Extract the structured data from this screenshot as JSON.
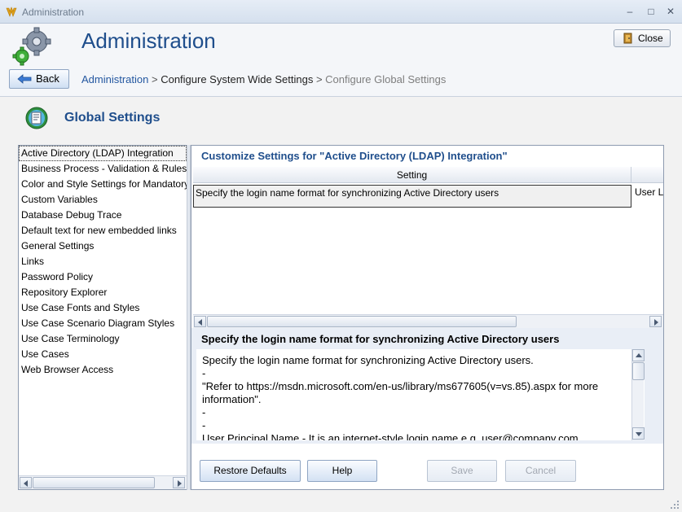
{
  "window": {
    "title": "Administration"
  },
  "header": {
    "title": "Administration",
    "close_label": "Close",
    "back_label": "Back",
    "breadcrumb": {
      "link": "Administration",
      "separator": " > ",
      "middle": "Configure System Wide Settings",
      "current": "Configure Global Settings"
    }
  },
  "section": {
    "title": "Global Settings"
  },
  "categories": [
    "Active Directory (LDAP) Integration",
    "Business Process - Validation & Rules",
    "Color and Style Settings for Mandatory",
    "Custom Variables",
    "Database Debug Trace",
    "Default text for new embedded links",
    "General Settings",
    "Links",
    "Password Policy",
    "Repository Explorer",
    "Use Case Fonts and Styles",
    "Use Case Scenario Diagram Styles",
    "Use Case Terminology",
    "Use Cases",
    "Web Browser Access"
  ],
  "customize": {
    "title": "Customize Settings for \"Active Directory (LDAP) Integration\"",
    "column_setting": "Setting",
    "rows": [
      {
        "setting": "Specify the login name format for synchronizing Active Directory users",
        "value": "User L"
      }
    ]
  },
  "description": {
    "title": "Specify the login name format for synchronizing Active Directory users",
    "lines": [
      "Specify the login name format for synchronizing Active Directory users.",
      "-",
      "\"Refer to https://msdn.microsoft.com/en-us/library/ms677605(v=vs.85).aspx for more information\".",
      "-",
      "-",
      "User Principal Name - It is an internet-style login name e.g. user@company.com"
    ]
  },
  "buttons": {
    "restore_defaults": "Restore Defaults",
    "help": "Help",
    "save": "Save",
    "cancel": "Cancel"
  },
  "colors": {
    "accent": "#1f4e8c",
    "link": "#2357a0"
  }
}
